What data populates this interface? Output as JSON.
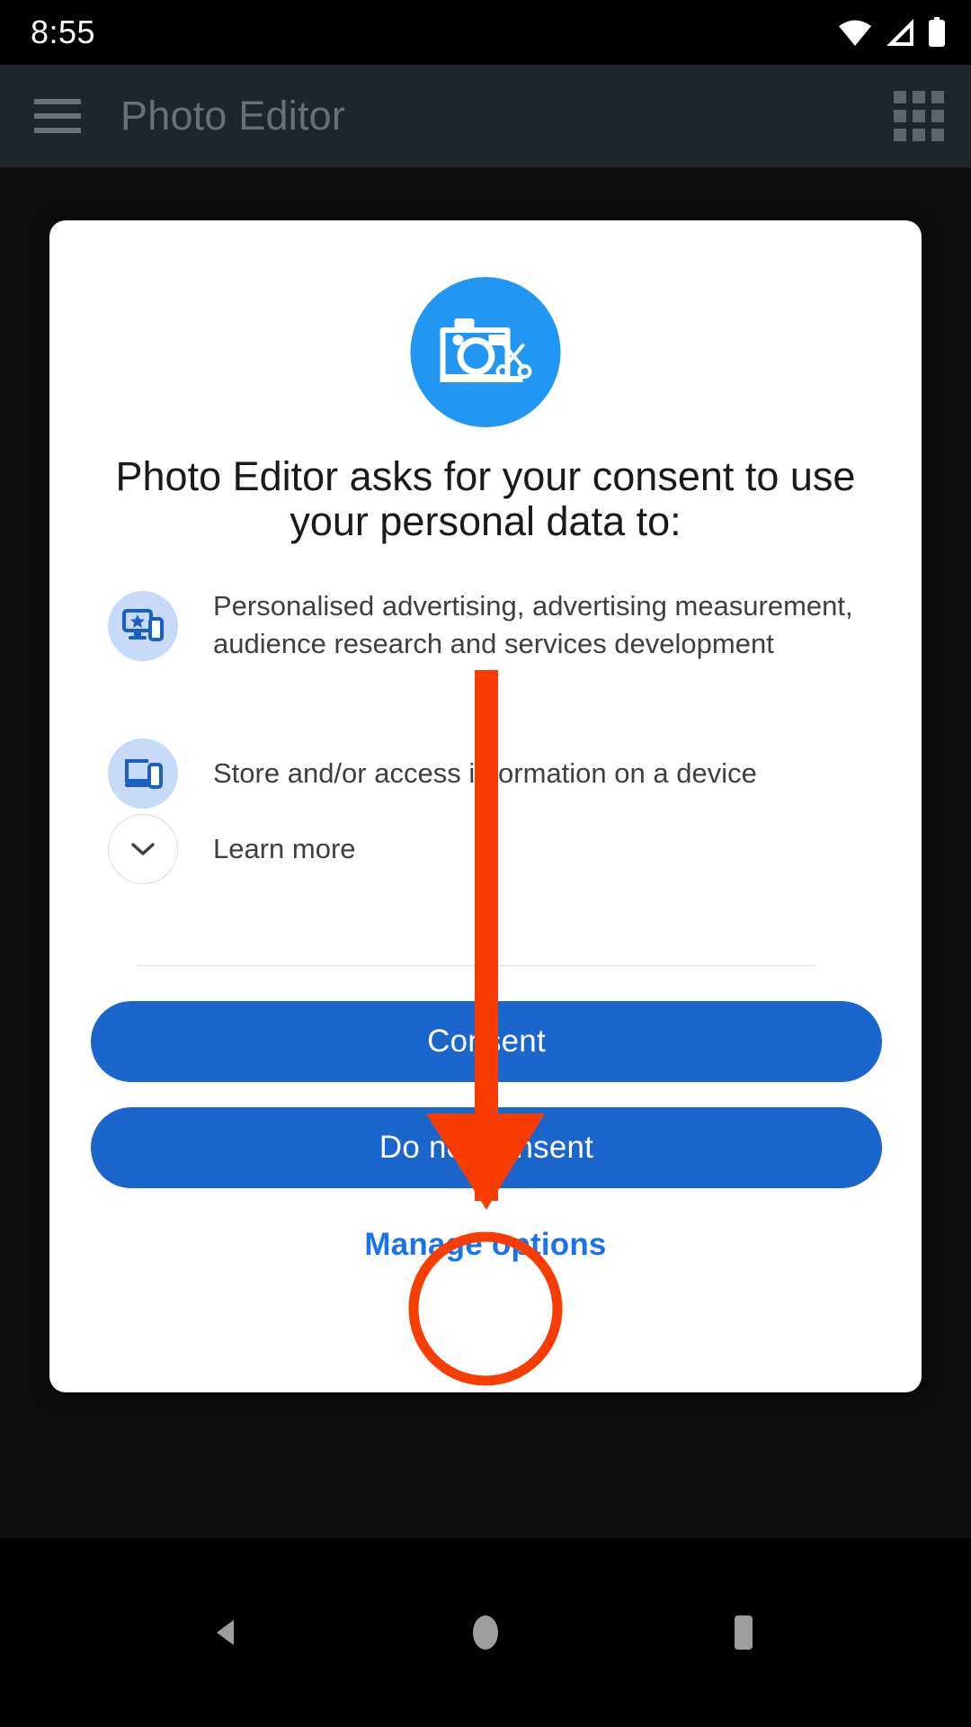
{
  "status_bar": {
    "clock": "8:55",
    "icons": [
      "wifi-icon",
      "cellular-signal-icon",
      "battery-icon"
    ]
  },
  "app_bar": {
    "menu_icon": "hamburger-menu-icon",
    "title": "Photo Editor",
    "grid_icon": "apps-grid-icon"
  },
  "dialog": {
    "logo_icon": "camera-scissors-app-icon",
    "title": "Photo Editor asks for your consent to use your personal data to:",
    "purposes": [
      {
        "icon": "personalised-ads-icon",
        "text": "Personalised advertising, advertising measurement, audience research and services development"
      },
      {
        "icon": "device-storage-icon",
        "text": "Store and/or access information on a device"
      }
    ],
    "learn_more": {
      "icon": "chevron-down-icon",
      "label": "Learn more"
    },
    "consent_label": "Consent",
    "do_not_consent_label": "Do not consent",
    "manage_options_label": "Manage options"
  },
  "nav_bar": {
    "back": "back-triangle-icon",
    "home": "home-circle-icon",
    "recents": "recents-square-icon"
  },
  "annotation": {
    "arrow_color": "#f93c00",
    "circle_color": "#f93c00",
    "target": "Manage options"
  },
  "colors": {
    "accent_blue": "#1b66cc",
    "link_blue": "#1a73e8",
    "logo_blue": "#2196f3",
    "icon_bg": "#c7dbf8",
    "app_bar_bg": "#1f262b",
    "screen_bg": "#0d0d0d"
  }
}
